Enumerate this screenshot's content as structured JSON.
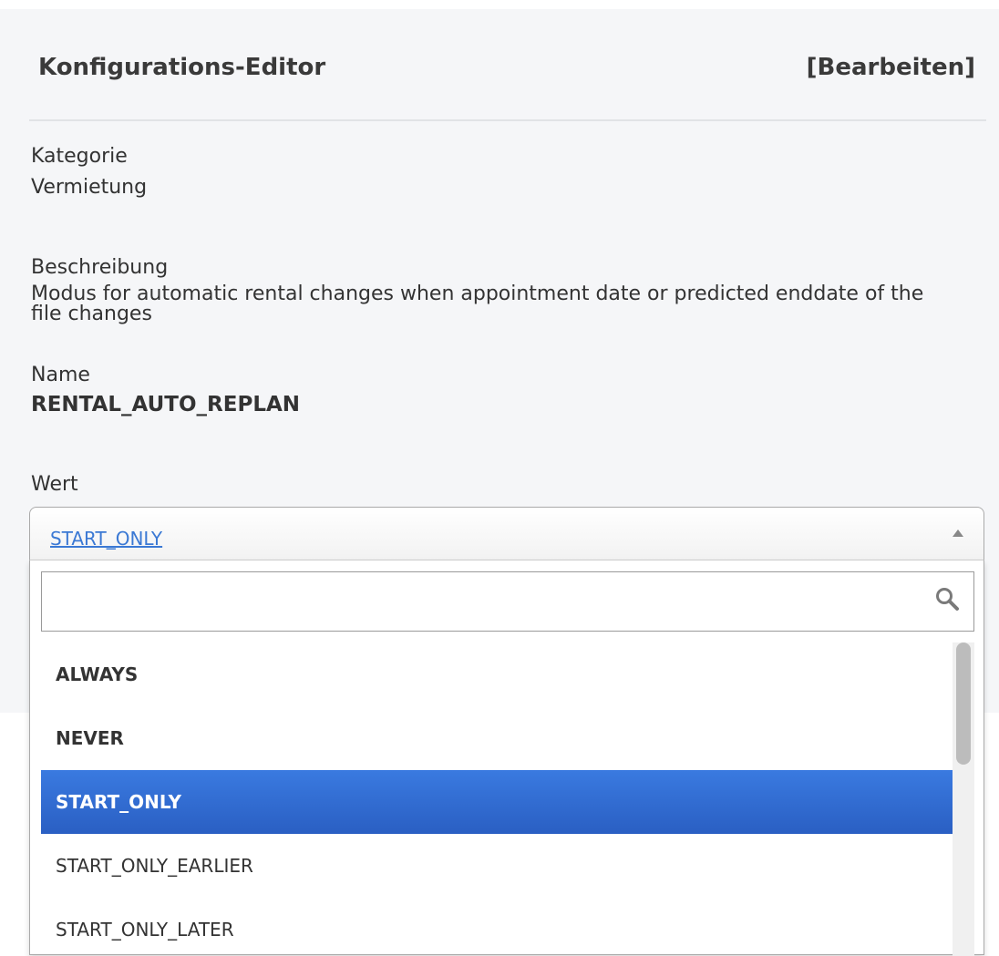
{
  "header": {
    "title": "Konfigurations-Editor",
    "edit_label": "[Bearbeiten]"
  },
  "fields": {
    "category": {
      "label": "Kategorie",
      "value": "Vermietung"
    },
    "description": {
      "label": "Beschreibung",
      "value": "Modus for automatic rental changes when appointment date or predicted enddate of the file changes"
    },
    "name": {
      "label": "Name",
      "value": "RENTAL_AUTO_REPLAN"
    },
    "value": {
      "label": "Wert"
    }
  },
  "select": {
    "selected_value": "START_ONLY",
    "search_placeholder": "",
    "options": [
      {
        "label": "ALWAYS",
        "selected": false
      },
      {
        "label": "NEVER",
        "selected": false
      },
      {
        "label": "START_ONLY",
        "selected": true
      },
      {
        "label": "START_ONLY_EARLIER",
        "selected": false
      },
      {
        "label": "START_ONLY_LATER",
        "selected": false
      }
    ]
  },
  "icons": {
    "search": "search-icon",
    "arrow": "chevron-up-icon"
  },
  "colors": {
    "accent": "#2a5fc3",
    "link": "#3b79d4",
    "panel_bg": "#f5f6f8"
  }
}
